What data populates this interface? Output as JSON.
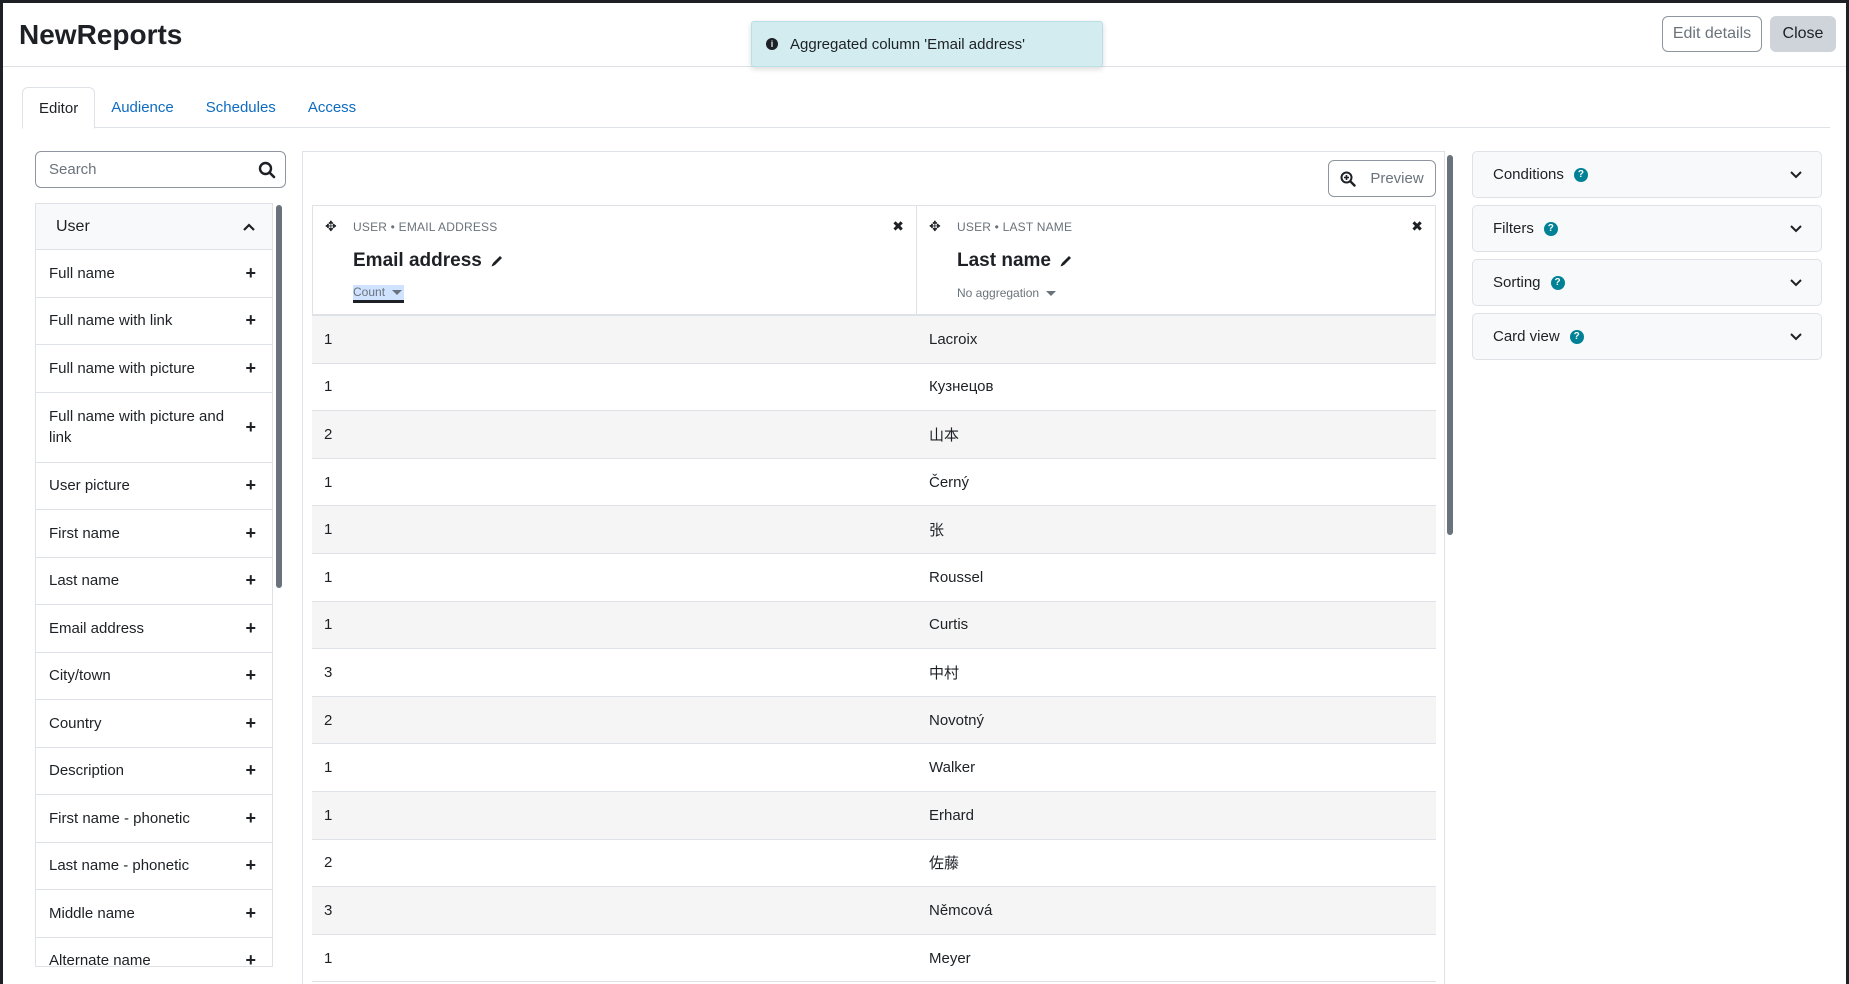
{
  "header": {
    "title": "NewReports",
    "edit_details": "Edit details",
    "close": "Close"
  },
  "toast": {
    "message": "Aggregated column 'Email address'"
  },
  "tabs": [
    {
      "label": "Editor",
      "active": true
    },
    {
      "label": "Audience"
    },
    {
      "label": "Schedules"
    },
    {
      "label": "Access"
    }
  ],
  "search": {
    "placeholder": "Search",
    "value": ""
  },
  "column_list": {
    "group": "User",
    "items": [
      "Full name",
      "Full name with link",
      "Full name with picture",
      "Full name with picture and link",
      "User picture",
      "First name",
      "Last name",
      "Email address",
      "City/town",
      "Country",
      "Description",
      "First name - phonetic",
      "Last name - phonetic",
      "Middle name",
      "Alternate name"
    ]
  },
  "preview": {
    "label": "Preview"
  },
  "table": {
    "columns": [
      {
        "source": "User • Email address",
        "name": "Email address",
        "aggregation": "Count"
      },
      {
        "source": "User • Last name",
        "name": "Last name",
        "aggregation": "No aggregation"
      }
    ],
    "rows": [
      [
        "1",
        "Lacroix"
      ],
      [
        "1",
        "Кузнецов"
      ],
      [
        "2",
        "山本"
      ],
      [
        "1",
        "Černý"
      ],
      [
        "1",
        "张"
      ],
      [
        "1",
        "Roussel"
      ],
      [
        "1",
        "Curtis"
      ],
      [
        "3",
        "中村"
      ],
      [
        "2",
        "Novotný"
      ],
      [
        "1",
        "Walker"
      ],
      [
        "1",
        "Erhard"
      ],
      [
        "2",
        "佐藤"
      ],
      [
        "3",
        "Němcová"
      ],
      [
        "1",
        "Meyer"
      ]
    ]
  },
  "sidebar_cards": [
    "Conditions",
    "Filters",
    "Sorting",
    "Card view"
  ],
  "colors": {
    "accent": "#0f6cbf",
    "help": "#008196",
    "toast_bg": "#d2ecf0"
  }
}
